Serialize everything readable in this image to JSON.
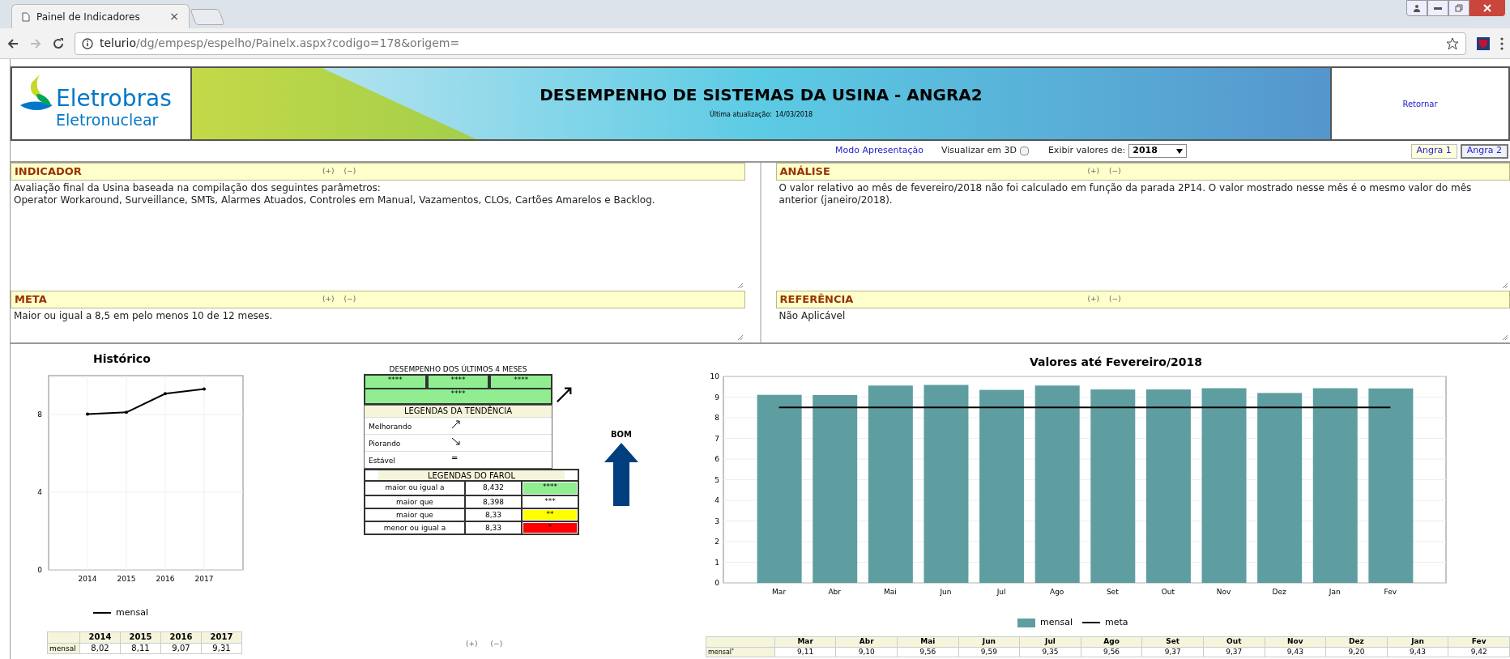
{
  "browser": {
    "tab_title": "Painel de Indicadores",
    "tab_close": "×",
    "url_host": "telurio",
    "url_path": "/dg/empesp/espelho/Painelx.aspx?codigo=178&origem="
  },
  "header": {
    "logo_name": "Eletrobras",
    "logo_sub": "Eletronuclear",
    "title": "DESEMPENHO DE SISTEMAS DA USINA - ANGRA2",
    "updated_label": "Última atualização:",
    "updated_value": "14/03/2018",
    "return_link": "Retornar"
  },
  "controls": {
    "presentation_link": "Modo Apresentação",
    "view3d_label": "Visualizar em 3D",
    "view3d_checked": false,
    "values_label": "Exibir valores de:",
    "year": "2018",
    "units": [
      {
        "label": "Angra 1",
        "selected": false
      },
      {
        "label": "Angra 2",
        "selected": true
      }
    ]
  },
  "panels": [
    {
      "title": "INDICADOR",
      "expand": "(+)",
      "collapse": "(−)",
      "text": "Avaliação final da Usina baseada na compilação dos seguintes parâmetros:\nOperator Workaround, Surveillance, SMTs, Alarmes Atuados, Controles em Manual, Vazamentos, CLOs, Cartões Amarelos e Backlog."
    },
    {
      "title": "ANÁLISE",
      "expand": "(+)",
      "collapse": "(−)",
      "text": "O valor relativo ao mês de fevereiro/2018 não foi calculado em função da parada 2P14. O valor mostrado nesse mês é o mesmo valor do mês anterior (janeiro/2018)."
    },
    {
      "title": "META",
      "expand": "(+)",
      "collapse": "(−)",
      "text": "Maior ou igual a 8,5 em pelo menos 10 de 12 meses."
    },
    {
      "title": "REFERÊNCIA",
      "expand": "(+)",
      "collapse": "(−)",
      "text": "Não Aplicável"
    }
  ],
  "historico": {
    "chart_data": {
      "type": "line",
      "title": "Histórico",
      "x": [
        2014,
        2015,
        2016,
        2017
      ],
      "series": [
        {
          "name": "mensal",
          "color": "#000000",
          "values": [
            8.02,
            8.11,
            9.07,
            9.31
          ]
        }
      ],
      "xlim": [
        2013,
        2018
      ],
      "ylim": [
        0,
        10
      ],
      "xticks": [
        2014,
        2015,
        2016,
        2017
      ],
      "yticks": [
        0,
        4,
        8
      ],
      "grid": true
    },
    "table": {
      "columns": [
        "2014",
        "2015",
        "2016",
        "2017"
      ],
      "row_label": "mensal",
      "values": [
        "8,02",
        "8,11",
        "9,07",
        "9,31"
      ]
    }
  },
  "desempenho": {
    "title": "DESEMPENHO DOS ÚLTIMOS 4 MESES",
    "months": [
      {
        "stars": "****",
        "color": "#90ee90"
      },
      {
        "stars": "****",
        "color": "#90ee90"
      },
      {
        "stars": "****",
        "color": "#90ee90"
      },
      {
        "stars": "****",
        "color": "#90ee90"
      }
    ],
    "trend_title": "LEGENDAS DA TENDÊNCIA",
    "trends": [
      {
        "label": "Melhorando",
        "kind": "up"
      },
      {
        "label": "Piorando",
        "kind": "down"
      },
      {
        "label": "Estável",
        "kind": "equal",
        "symbol": "="
      }
    ],
    "farol_title": "LEGENDAS DO FAROL",
    "farol": [
      {
        "condition": "maior ou igual a",
        "value": "8,432",
        "stars": "****",
        "color": "#90ee90"
      },
      {
        "condition": "maior que",
        "value": "8,398",
        "stars": "***",
        "color": "#ffffff"
      },
      {
        "condition": "maior que",
        "value": "8,33",
        "stars": "**",
        "color": "#ffff00"
      },
      {
        "condition": "menor ou igual a",
        "value": "8,33",
        "stars": "*",
        "color": "#ff0000"
      }
    ],
    "expand": "(+)",
    "collapse": "(−)"
  },
  "status": {
    "label": "BOM"
  },
  "valores": {
    "chart_data": {
      "type": "bar",
      "title": "Valores até Fevereiro/2018",
      "categories": [
        "Mar",
        "Abr",
        "Mai",
        "Jun",
        "Jul",
        "Ago",
        "Set",
        "Out",
        "Nov",
        "Dez",
        "Jan",
        "Fev"
      ],
      "series": [
        {
          "name": "mensal",
          "color": "#5f9ea0",
          "values": [
            9.11,
            9.1,
            9.56,
            9.59,
            9.35,
            9.56,
            9.37,
            9.37,
            9.43,
            9.2,
            9.43,
            9.42
          ]
        },
        {
          "name": "meta",
          "color": "#000000",
          "type": "line",
          "values": [
            8.5,
            8.5,
            8.5,
            8.5,
            8.5,
            8.5,
            8.5,
            8.5,
            8.5,
            8.5,
            8.5,
            8.5
          ]
        }
      ],
      "ylim": [
        0,
        10
      ],
      "yticks": [
        0,
        1,
        2,
        3,
        4,
        5,
        6,
        7,
        8,
        9,
        10
      ],
      "grid": true
    },
    "table": {
      "row_label": "mensal$^{*}$",
      "columns": [
        "Mar",
        "Abr",
        "Mai",
        "Jun",
        "Jul",
        "Ago",
        "Set",
        "Out",
        "Nov",
        "Dez",
        "Jan",
        "Fev"
      ],
      "values": [
        "9,11",
        "9,10",
        "9,56",
        "9,59",
        "9,35",
        "9,56",
        "9,37",
        "9,37",
        "9,43",
        "9,20",
        "9,43",
        "9,42"
      ]
    }
  }
}
